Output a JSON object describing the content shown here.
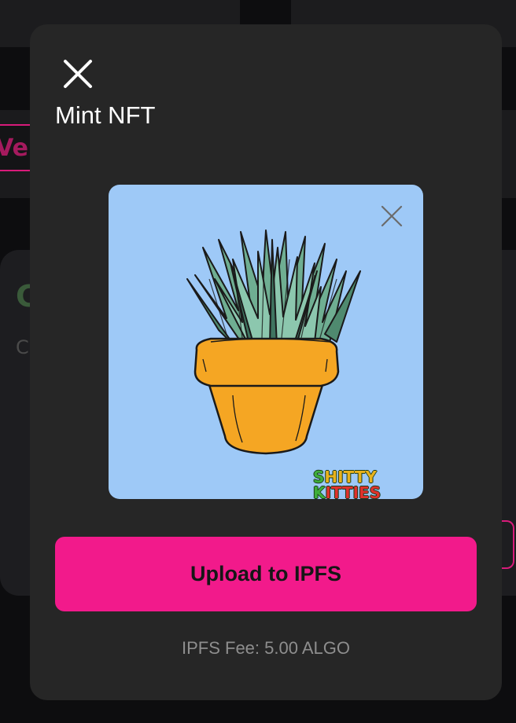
{
  "modal": {
    "title": "Mint NFT",
    "upload_label": "Upload to IPFS",
    "fee_text": "IPFS Fee: 5.00 ALGO"
  },
  "preview": {
    "watermark_parts": [
      "S",
      "HITTY ",
      "K",
      "ITTIES"
    ],
    "watermark_text": "SHITTY KITTIES"
  },
  "background": {
    "partial_chip_text": "Ve",
    "partial_heading_text": "C",
    "partial_sub_text": "C"
  },
  "icons": {
    "close": "close-icon",
    "remove_image": "close-icon"
  },
  "colors": {
    "accent": "#f21a8b",
    "modal_bg": "#262626",
    "page_bg": "#0d0d0f",
    "preview_bg": "#9ec9f7",
    "fee_text": "#8e8e8e"
  }
}
